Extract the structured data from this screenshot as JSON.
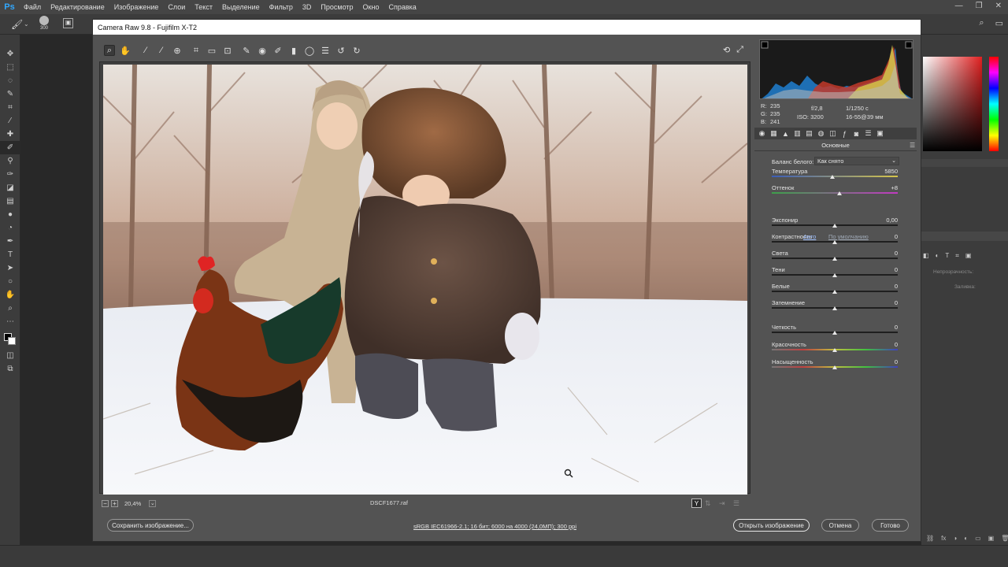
{
  "ps": {
    "logo": "Ps",
    "menu": [
      "Файл",
      "Редактирование",
      "Изображение",
      "Слои",
      "Текст",
      "Выделение",
      "Фильтр",
      "3D",
      "Просмотр",
      "Окно",
      "Справка"
    ],
    "brush_size": "300",
    "layers_opacity_label": "Непрозрачность:",
    "layers_fill_label": "Заливка:"
  },
  "dialog": {
    "title": "Camera Raw 9.8  -  Fujifilm X-T2",
    "filename": "DSCF1677.raf",
    "zoom": "20,4%",
    "workflow_link": "sRGB IEC61966-2.1; 16 бит; 6000 на 4000 (24,0МП); 300 ppi",
    "save_button": "Сохранить изображение...",
    "open_button": "Открыть изображение",
    "cancel_button": "Отмена",
    "done_button": "Готово"
  },
  "info": {
    "r_label": "R:",
    "r": "235",
    "g_label": "G:",
    "g": "235",
    "b_label": "B:",
    "b": "241",
    "aperture": "f/2,8",
    "shutter": "1/1250 с",
    "iso": "ISO: 3200",
    "lens": "16-55@39 мм"
  },
  "panel": {
    "title": "Основные",
    "wb_label": "Баланс белого:",
    "wb_value": "Как снято",
    "auto_link": "Авто",
    "default_link": "По умолчанию",
    "sliders": [
      {
        "label": "Температура",
        "value": "5850",
        "level": 0.48
      },
      {
        "label": "Оттенок",
        "value": "+8",
        "level": 0.54
      },
      {
        "label": "Экспонир",
        "value": "0,00",
        "level": 0.5
      },
      {
        "label": "Контрастность",
        "value": "0",
        "level": 0.5
      },
      {
        "label": "Света",
        "value": "0",
        "level": 0.5
      },
      {
        "label": "Тени",
        "value": "0",
        "level": 0.5
      },
      {
        "label": "Белые",
        "value": "0",
        "level": 0.5
      },
      {
        "label": "Затемнение",
        "value": "0",
        "level": 0.5
      },
      {
        "label": "Четкость",
        "value": "0",
        "level": 0.5
      },
      {
        "label": "Красочность",
        "value": "0",
        "level": 0.5
      },
      {
        "label": "Насыщенность",
        "value": "0",
        "level": 0.5
      }
    ]
  }
}
